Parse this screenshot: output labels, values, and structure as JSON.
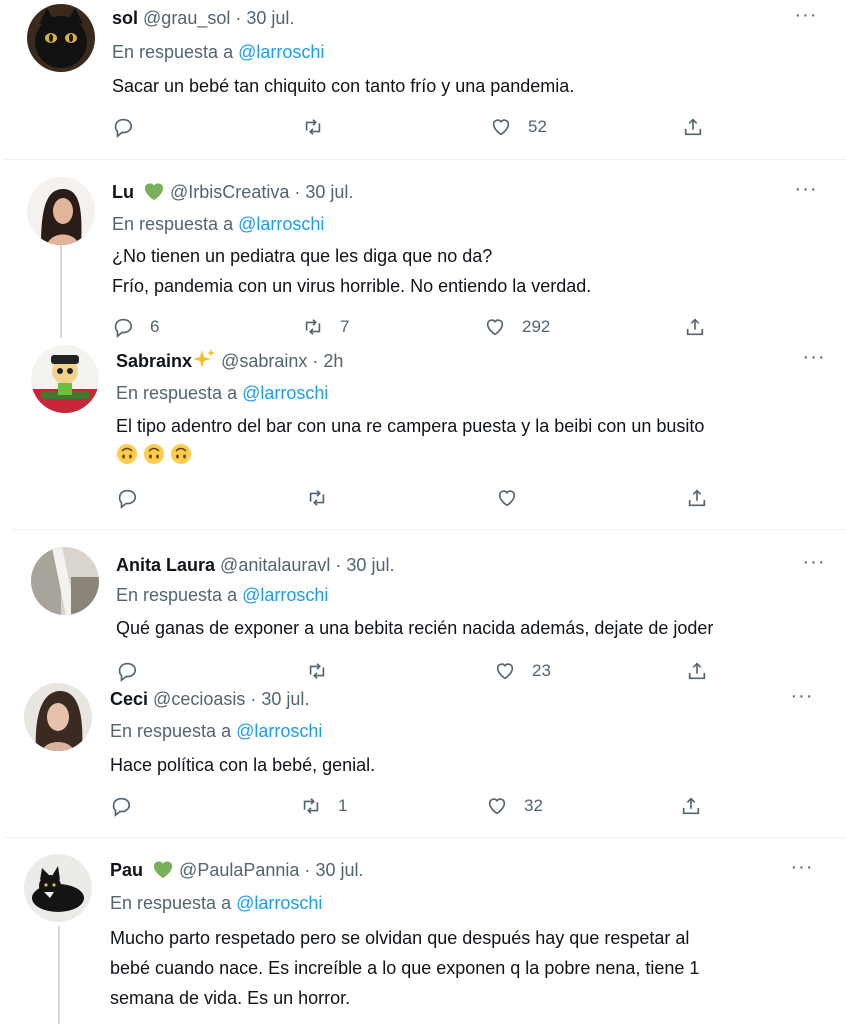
{
  "reply_prefix": "En respuesta a",
  "tweets": [
    {
      "name": "sol",
      "badge": "",
      "handle": "@grau_sol",
      "sep": "·",
      "date": "30 jul.",
      "mention": "@larroschi",
      "lines": [
        "Sacar un bebé tan chiquito con tanto frío y una pandemia."
      ],
      "replies": "",
      "retweets": "",
      "likes": "52"
    },
    {
      "name": "Lu",
      "badge": "green-heart",
      "handle": "@IrbisCreativa",
      "sep": "·",
      "date": "30 jul.",
      "mention": "@larroschi",
      "lines": [
        "¿No tienen un pediatra que les diga que no da?",
        "Frío, pandemia con un virus horrible. No entiendo la verdad."
      ],
      "replies": "6",
      "retweets": "7",
      "likes": "292"
    },
    {
      "name": "Sabrainx",
      "badge": "sparkles",
      "handle": "@sabrainx",
      "sep": "·",
      "date": "2h",
      "mention": "@larroschi",
      "lines": [
        "El tipo adentro del bar con una re campera puesta y la beibi con un busito"
      ],
      "emojis": "upside-down-faces",
      "replies": "",
      "retweets": "",
      "likes": ""
    },
    {
      "name": "Anita Laura",
      "badge": "",
      "handle": "@anitalauravl",
      "sep": "·",
      "date": "30 jul.",
      "mention": "@larroschi",
      "lines": [
        "Qué ganas de exponer a una bebita recién nacida además, dejate de joder"
      ],
      "replies": "",
      "retweets": "",
      "likes": "23"
    },
    {
      "name": "Ceci",
      "badge": "",
      "handle": "@cecioasis",
      "sep": "·",
      "date": "30 jul.",
      "mention": "@larroschi",
      "lines": [
        "Hace política con la bebé, genial."
      ],
      "replies": "",
      "retweets": "1",
      "likes": "32"
    },
    {
      "name": "Pau",
      "badge": "green-heart",
      "handle": "@PaulaPannia",
      "sep": "·",
      "date": "30 jul.",
      "mention": "@larroschi",
      "lines": [
        "Mucho parto respetado pero se olvidan que después hay que respetar al",
        "bebé cuando nace. Es increíble a lo que exponen q la pobre nena, tiene 1",
        "semana de vida. Es un horror."
      ],
      "replies": "",
      "retweets": "",
      "likes": ""
    }
  ],
  "colors": {
    "mention": "#1d9bf0",
    "muted": "#536471",
    "text": "#0f1419",
    "heart_badge": "#78b159",
    "divider": "#eff3f4"
  },
  "icons": {
    "reply": "reply-icon",
    "retweet": "retweet-icon",
    "like": "heart-icon",
    "share": "share-icon",
    "more": "more-icon"
  }
}
